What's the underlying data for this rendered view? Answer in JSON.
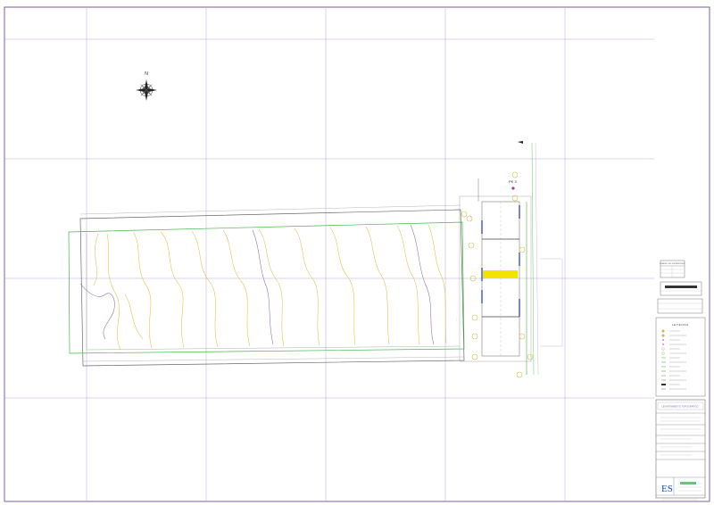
{
  "sheet": {
    "north_label": "N",
    "point_label": "PK 3",
    "surface_table_header": "CUADRO DE SUPERFICIES",
    "legend_heading": "L E Y E N D A",
    "drawing_title": "LEVANTAMIENTO TOPOGRÁFICO",
    "logo_text": "ES"
  },
  "colors": {
    "grid": "#b9a7cf",
    "border": "#7a5fa0",
    "contour": "#d8c34a",
    "boundary": "#6a6a6a",
    "green_line": "#43b545",
    "highlight": "#f2e400",
    "blue_marker": "#1f2fc8",
    "logo_blue": "#1a4fa8",
    "logo_green": "#3aa84a"
  },
  "legend_items": [
    {
      "icon": "tree-symbol"
    },
    {
      "icon": "tree-symbol"
    },
    {
      "icon": "marker-symbol"
    },
    {
      "icon": "marker-symbol"
    },
    {
      "icon": "circle-symbol"
    },
    {
      "icon": "circle-symbol"
    },
    {
      "icon": "line-symbol"
    },
    {
      "icon": "line-symbol"
    },
    {
      "icon": "line-symbol"
    },
    {
      "icon": "line-symbol"
    },
    {
      "icon": "line-symbol"
    },
    {
      "icon": "line-symbol"
    },
    {
      "icon": "fill-symbol"
    },
    {
      "icon": "line-symbol"
    }
  ]
}
